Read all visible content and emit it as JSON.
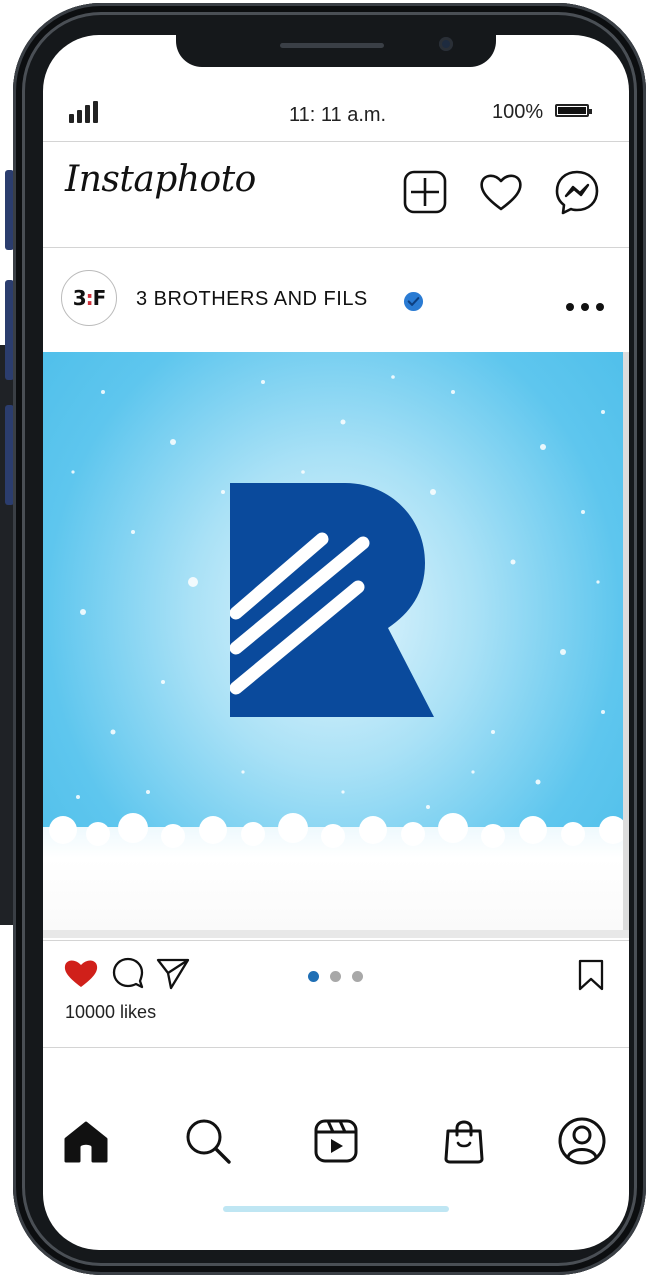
{
  "status_bar": {
    "time": "11: 11 a.m.",
    "battery": "100%"
  },
  "header": {
    "app_title": "Instaphoto",
    "icons": [
      "add-post-icon",
      "heart-icon",
      "messenger-icon"
    ]
  },
  "post": {
    "avatar_text_left": "3",
    "avatar_text_sep": ":",
    "avatar_text_right": "F",
    "account_name": "3 BROTHERS AND FILS",
    "verified": true,
    "liked": true,
    "likes": "10000 likes",
    "carousel": {
      "count": 3,
      "active_index": 0
    }
  },
  "bottom_nav": {
    "items": [
      "home-icon",
      "search-icon",
      "reels-icon",
      "shop-icon",
      "profile-icon"
    ],
    "active": "home-icon"
  },
  "colors": {
    "like_red": "#d0201a",
    "verified_blue": "#2a7bd3",
    "logo_blue": "#0a4a9c",
    "dot_active": "#1f6fb5",
    "dot_inactive": "#a8a8a8",
    "home_indicator": "#bfe6f3"
  }
}
